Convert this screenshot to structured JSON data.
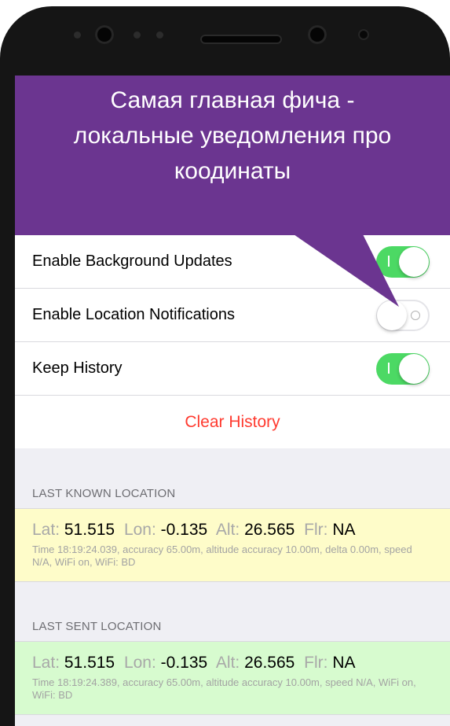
{
  "banner": {
    "line1": "Самая главная фича -",
    "line2": "локальные уведомления про",
    "line3": "коодинаты",
    "color": "#6b3590"
  },
  "settings": {
    "rows": [
      {
        "label": "Enable Background Updates",
        "state": "on"
      },
      {
        "label": "Enable Location Notifications",
        "state": "off"
      },
      {
        "label": "Keep History",
        "state": "on"
      }
    ],
    "clear_label": "Clear History",
    "toggle_on_color": "#4cd964",
    "destructive_color": "#ff3b30"
  },
  "last_known": {
    "header": "LAST KNOWN LOCATION",
    "lat_key": "Lat:",
    "lat": "51.515",
    "lon_key": "Lon:",
    "lon": "-0.135",
    "alt_key": "Alt:",
    "alt": "26.565",
    "flr_key": "Flr:",
    "flr": "NA",
    "detail": "Time 18:19:24.039, accuracy 65.00m, altitude accuracy 10.00m, delta 0.00m, speed N/A, WiFi on, WiFi: BD",
    "bg_color": "#fefcc9"
  },
  "last_sent": {
    "header": "LAST SENT LOCATION",
    "lat_key": "Lat:",
    "lat": "51.515",
    "lon_key": "Lon:",
    "lon": "-0.135",
    "alt_key": "Alt:",
    "alt": "26.565",
    "flr_key": "Flr:",
    "flr": "NA",
    "detail": "Time 18:19:24.389, accuracy 65.00m, altitude accuracy 10.00m, speed N/A, WiFi on, WiFi: BD",
    "bg_color": "#d7fbcf"
  }
}
